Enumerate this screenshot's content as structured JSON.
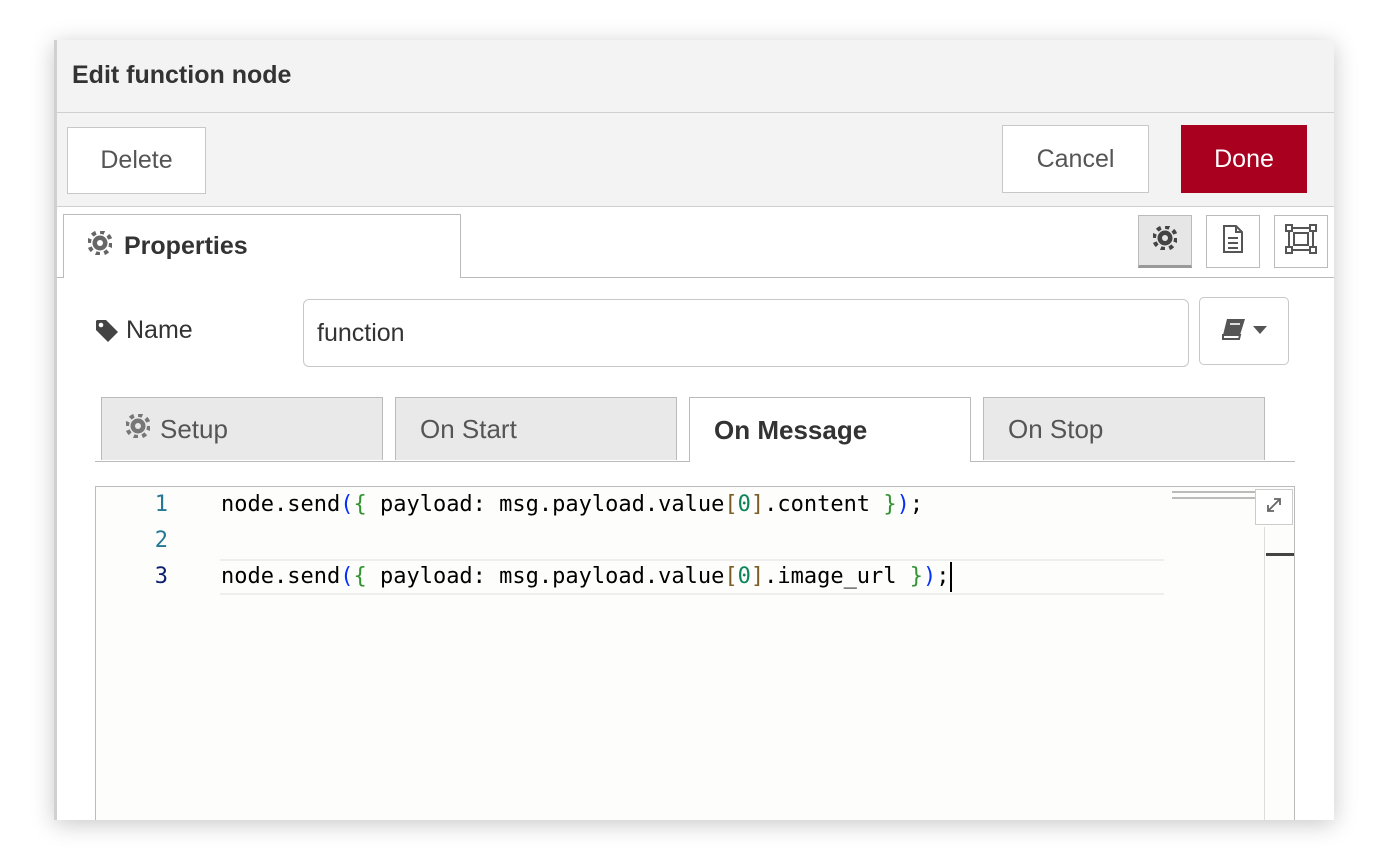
{
  "dialog": {
    "title": "Edit function node",
    "delete_label": "Delete",
    "cancel_label": "Cancel",
    "done_label": "Done",
    "accent_color": "#aa0020"
  },
  "tabs": {
    "properties_label": "Properties",
    "icons": [
      "gear-icon",
      "document-icon",
      "frame-icon"
    ]
  },
  "name_field": {
    "label": "Name",
    "value": "function"
  },
  "code_tabs": [
    {
      "label": "Setup"
    },
    {
      "label": "On Start"
    },
    {
      "label": "On Message",
      "active": true
    },
    {
      "label": "On Stop"
    }
  ],
  "editor": {
    "lines": [
      {
        "number": "1",
        "text": "node.send({ payload: msg.payload.value[0].content });"
      },
      {
        "number": "2",
        "text": ""
      },
      {
        "number": "3",
        "text": "node.send({ payload: msg.payload.value[0].image_url });"
      }
    ]
  }
}
